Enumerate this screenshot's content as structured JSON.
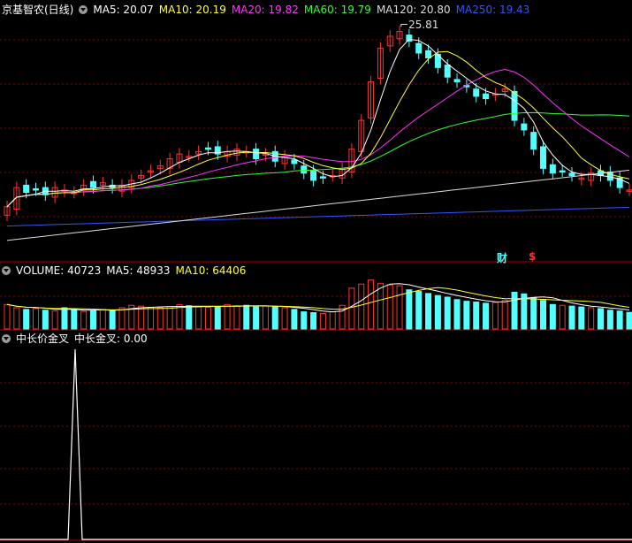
{
  "title": "京基智农(日线)",
  "ma_legend": [
    {
      "label": "MA5: 20.07",
      "color": "#ffffff"
    },
    {
      "label": "MA10: 20.19",
      "color": "#ffff33"
    },
    {
      "label": "MA20: 19.82",
      "color": "#ff33ff"
    },
    {
      "label": "MA60: 19.79",
      "color": "#33ff33"
    },
    {
      "label": "MA120: 20.80",
      "color": "#dddddd"
    },
    {
      "label": "MA250: 19.43",
      "color": "#3355ff"
    }
  ],
  "max_price_label": "25.81",
  "events": {
    "fin": "财",
    "dollar": "$"
  },
  "volume_legend": [
    {
      "label": "VOLUME: 40723",
      "color": "#ffffff"
    },
    {
      "label": "MA5: 48933",
      "color": "#ffffff"
    },
    {
      "label": "MA10: 64406",
      "color": "#ffff33"
    }
  ],
  "indicator_legend": [
    {
      "label": "中长价金叉",
      "color": "#ffffff"
    },
    {
      "label": "中长金叉: 0.00",
      "color": "#ffffff"
    }
  ],
  "colors": {
    "up": "#ff3333",
    "down": "#54ffff",
    "grid": "#880000",
    "border": "#aa0000",
    "ma250": "#3355ff",
    "ma120": "#dddddd",
    "ma60": "#33ff33",
    "ma20": "#ff33ff",
    "ma10": "#ffff33",
    "ma5": "#ffffff"
  },
  "chart_data": {
    "type": "candlestick",
    "closes": [
      18.2,
      19.0,
      18.8,
      18.9,
      18.7,
      19.0,
      18.9,
      18.8,
      19.1,
      19.0,
      19.2,
      19.0,
      19.1,
      19.3,
      19.5,
      19.7,
      19.9,
      20.2,
      20.4,
      20.3,
      20.5,
      20.6,
      20.4,
      20.5,
      20.6,
      20.5,
      20.2,
      20.4,
      20.1,
      20.3,
      20.0,
      19.6,
      19.3,
      19.4,
      19.5,
      19.8,
      20.6,
      21.8,
      23.4,
      24.8,
      25.3,
      25.5,
      25.1,
      24.6,
      24.4,
      24.0,
      23.6,
      23.4,
      23.2,
      22.8,
      22.7,
      22.9,
      23.1,
      21.8,
      21.4,
      20.6,
      19.8,
      19.6,
      19.7,
      19.5,
      19.4,
      19.6,
      19.5,
      19.3,
      19.0,
      18.9
    ],
    "volumes": [
      60000,
      52000,
      48000,
      50000,
      46000,
      44000,
      52000,
      47000,
      43000,
      45000,
      48000,
      46000,
      52000,
      58000,
      56000,
      53000,
      52000,
      55000,
      60000,
      57000,
      54000,
      53000,
      55000,
      60000,
      57000,
      58000,
      54000,
      56000,
      55000,
      52000,
      48000,
      42000,
      40000,
      38000,
      42000,
      58000,
      100000,
      110000,
      120000,
      112000,
      108000,
      106000,
      96000,
      92000,
      87000,
      82000,
      78000,
      72000,
      68000,
      66000,
      63000,
      65000,
      70000,
      90000,
      86000,
      76000,
      70000,
      60000,
      58000,
      56000,
      54000,
      52000,
      50000,
      46000,
      44000,
      40723
    ]
  }
}
